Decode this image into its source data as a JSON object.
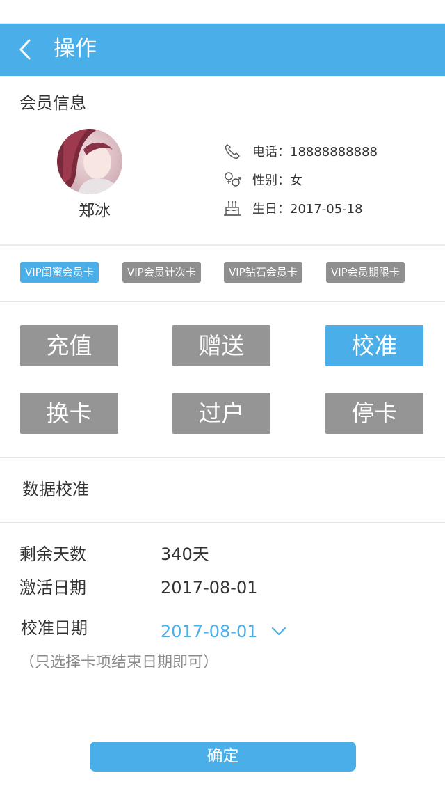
{
  "header": {
    "title": "操作"
  },
  "member": {
    "section_title": "会员信息",
    "name": "郑冰",
    "phone_text": "电话：18888888888",
    "gender_text": "性别：女",
    "birthday_text": "生日：2017-05-18"
  },
  "cards": [
    {
      "label": "VIP闺蜜会员卡",
      "selected": true
    },
    {
      "label": "VIP会员计次卡",
      "selected": false
    },
    {
      "label": "VIP钻石会员卡",
      "selected": false
    },
    {
      "label": "VIP会员期限卡",
      "selected": false
    }
  ],
  "operations": [
    {
      "label": "充值",
      "selected": false
    },
    {
      "label": "赠送",
      "selected": false
    },
    {
      "label": "校准",
      "selected": true
    },
    {
      "label": "换卡",
      "selected": false
    },
    {
      "label": "过户",
      "selected": false
    },
    {
      "label": "停卡",
      "selected": false
    }
  ],
  "calibration": {
    "section_title": "数据校准",
    "remaining_days_label": "剩余天数",
    "remaining_days_value": "340天",
    "activation_date_label": "激活日期",
    "activation_date_value": "2017-08-01",
    "calibration_date_label": "校准日期",
    "calibration_date_value": "2017-08-01",
    "hint": "（只选择卡项结束日期即可）"
  },
  "confirm_label": "确定",
  "colors": {
    "accent": "#4aaee9",
    "button_gray": "#959595",
    "tag_gray": "#8f8f8f"
  }
}
